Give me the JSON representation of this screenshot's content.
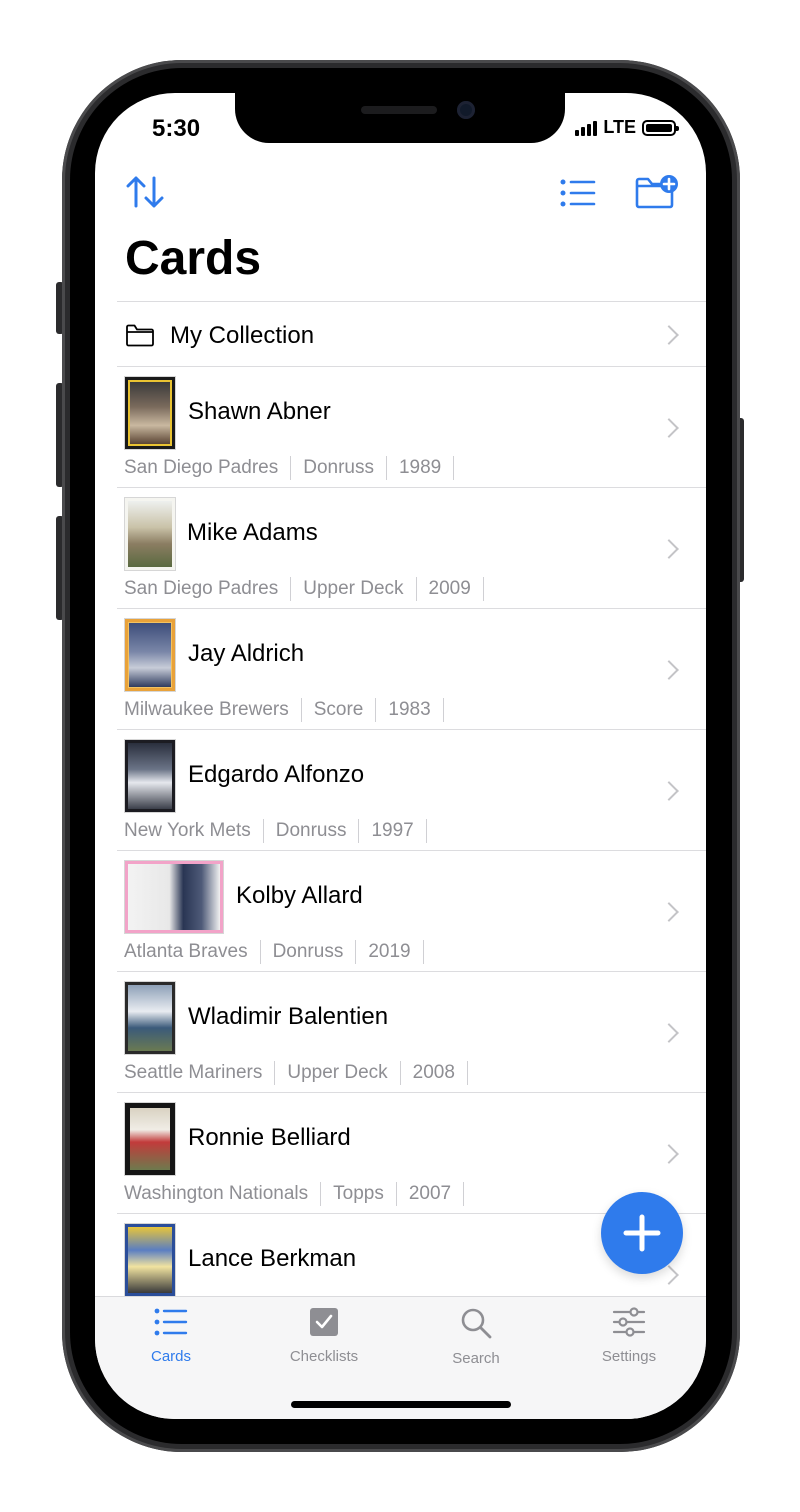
{
  "status_bar": {
    "time": "5:30",
    "network": "LTE"
  },
  "toolbar": {
    "sort_icon": "sort-arrows-icon",
    "list_icon": "list-icon",
    "new_folder_icon": "folder-plus-icon",
    "accent": "#2f7bec"
  },
  "page_title": "Cards",
  "folder": {
    "label": "My Collection",
    "icon": "folder-icon"
  },
  "cards": [
    {
      "name": "Shawn Abner",
      "team": "San Diego Padres",
      "brand": "Donruss",
      "year": "1989"
    },
    {
      "name": "Mike Adams",
      "team": "San Diego Padres",
      "brand": "Upper Deck",
      "year": "2009"
    },
    {
      "name": "Jay Aldrich",
      "team": "Milwaukee Brewers",
      "brand": "Score",
      "year": "1983"
    },
    {
      "name": "Edgardo Alfonzo",
      "team": "New York Mets",
      "brand": "Donruss",
      "year": "1997"
    },
    {
      "name": "Kolby Allard",
      "team": "Atlanta Braves",
      "brand": "Donruss",
      "year": "2019"
    },
    {
      "name": "Wladimir Balentien",
      "team": "Seattle Mariners",
      "brand": "Upper Deck",
      "year": "2008"
    },
    {
      "name": "Ronnie Belliard",
      "team": "Washington Nationals",
      "brand": "Topps",
      "year": "2007"
    },
    {
      "name": "Lance Berkman"
    }
  ],
  "fab": {
    "icon": "plus-icon"
  },
  "tabs": [
    {
      "label": "Cards",
      "icon": "list-icon",
      "active": true
    },
    {
      "label": "Checklists",
      "icon": "checkbox-icon",
      "active": false
    },
    {
      "label": "Search",
      "icon": "search-icon",
      "active": false
    },
    {
      "label": "Settings",
      "icon": "sliders-icon",
      "active": false
    }
  ]
}
